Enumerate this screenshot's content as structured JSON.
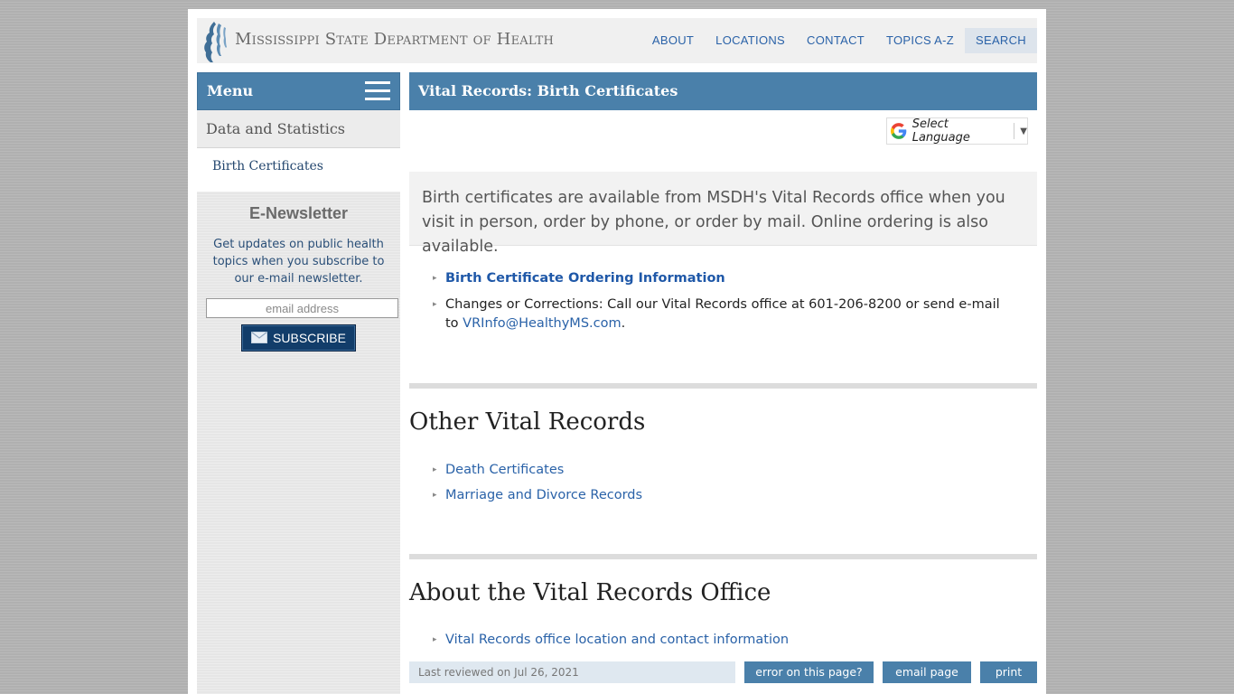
{
  "header": {
    "site_title": "Mississippi State Department of Health",
    "nav": [
      "ABOUT",
      "LOCATIONS",
      "CONTACT",
      "TOPICS A-Z",
      "SEARCH"
    ]
  },
  "sidebar": {
    "menu_label": "Menu",
    "section": "Data and Statistics",
    "sub_item": "Birth Certificates",
    "newsletter": {
      "title": "E-Newsletter",
      "text": "Get updates on public health topics when you subscribe to our e-mail newsletter.",
      "email_placeholder": "email address",
      "subscribe_label": "SUBSCRIBE"
    }
  },
  "main": {
    "title": "Vital Records: Birth Certificates",
    "translate_label": "Select Language",
    "intro": "Birth certificates are available from MSDH's Vital Records office when you visit in person, order by phone, or order by mail. Online ordering is also available.",
    "list1": {
      "ordering_link": "Birth Certificate Ordering Information",
      "changes_text": "Changes or Corrections: Call our Vital Records office at 601-206-8200 or send e-mail to",
      "email_link": "VRInfo@HealthyMS.com",
      "period": "."
    },
    "other_heading": "Other Vital Records",
    "other_links": [
      "Death Certificates",
      "Marriage and Divorce Records"
    ],
    "about_heading": "About the Vital Records Office",
    "about_links": [
      "Vital Records office location and contact information"
    ],
    "footer": {
      "last_reviewed": "Last reviewed on Jul 26, 2021",
      "error_button": "error on this page?",
      "email_button": "email page",
      "print_button": "print"
    }
  },
  "colors": {
    "brand_blue": "#4a80aa",
    "link_blue": "#2a62a8",
    "subscribe_navy": "#123d6a"
  }
}
